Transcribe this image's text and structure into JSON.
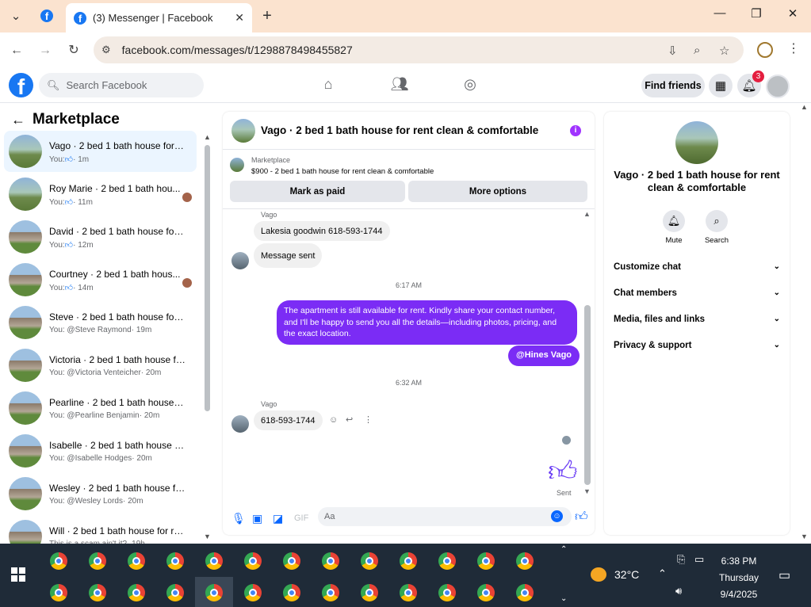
{
  "browser": {
    "tab_title": "(3) Messenger | Facebook",
    "url": "facebook.com/messages/t/1298878498455827"
  },
  "fb": {
    "search_placeholder": "Search Facebook",
    "find_friends": "Find friends",
    "notification_count": "3"
  },
  "left": {
    "title": "Marketplace",
    "conversations": [
      {
        "name": "Vago · 2 bed 1 bath house for r...",
        "sub_prefix": "You:",
        "sub_suffix": "· 1m",
        "like": true,
        "active": true
      },
      {
        "name": "Roy Marie · 2 bed 1 bath hou...",
        "sub_prefix": "You:",
        "sub_suffix": "· 11m",
        "like": true
      },
      {
        "name": "David · 2 bed 1 bath house for r...",
        "sub_prefix": "You:",
        "sub_suffix": "· 12m",
        "like": true
      },
      {
        "name": "Courtney · 2 bed 1 bath hous...",
        "sub_prefix": "You:",
        "sub_suffix": "· 14m",
        "like": true
      },
      {
        "name": "Steve · 2 bed 1 bath house for r...",
        "sub_prefix": "You: @Steve Raymond",
        "sub_suffix": "· 19m"
      },
      {
        "name": "Victoria · 2 bed 1 bath house fo...",
        "sub_prefix": "You: @Victoria Venteicher",
        "sub_suffix": "· 20m"
      },
      {
        "name": "Pearline · 2 bed 1 bath house fo...",
        "sub_prefix": "You: @Pearline Benjamin",
        "sub_suffix": "· 20m"
      },
      {
        "name": "Isabelle · 2 bed 1 bath house for...",
        "sub_prefix": "You: @Isabelle Hodges",
        "sub_suffix": "· 20m"
      },
      {
        "name": "Wesley · 2 bed 1 bath house for...",
        "sub_prefix": "You: @Wesley Lords",
        "sub_suffix": "· 20m"
      },
      {
        "name": "Will · 2 bed 1 bath house for re...",
        "sub_prefix": "This is a scam ain't it?",
        "sub_suffix": "· 19h"
      }
    ]
  },
  "chat": {
    "title": "Vago · 2 bed 1 bath house for rent clean & comfortable",
    "marketplace_label": "Marketplace",
    "listing": "$900 - 2 bed 1 bath house for rent clean & comfortable",
    "mark_paid": "Mark as paid",
    "more_options": "More options",
    "sender1": "Vago",
    "msg1": "Lakesia goodwin 618-593-1744",
    "msg2": "Message sent",
    "time1": "6:17 AM",
    "out_msg": "The apartment is still available for rent. Kindly share your contact number, and I'll be happy to send you all the details—including photos, pricing, and the exact location.",
    "mention": "@Hines Vago",
    "time2": "6:32 AM",
    "sender2": "Vago",
    "msg3": "618-593-1744",
    "sent": "Sent",
    "composer_placeholder": "Aa"
  },
  "info": {
    "title": "Vago · 2 bed 1 bath house for rent clean & comfortable",
    "mute": "Mute",
    "search": "Search",
    "rows": [
      "Customize chat",
      "Chat members",
      "Media, files and links",
      "Privacy & support"
    ]
  },
  "taskbar": {
    "temperature": "32°C",
    "time": "6:38 PM",
    "day": "Thursday",
    "date": "9/4/2025"
  }
}
